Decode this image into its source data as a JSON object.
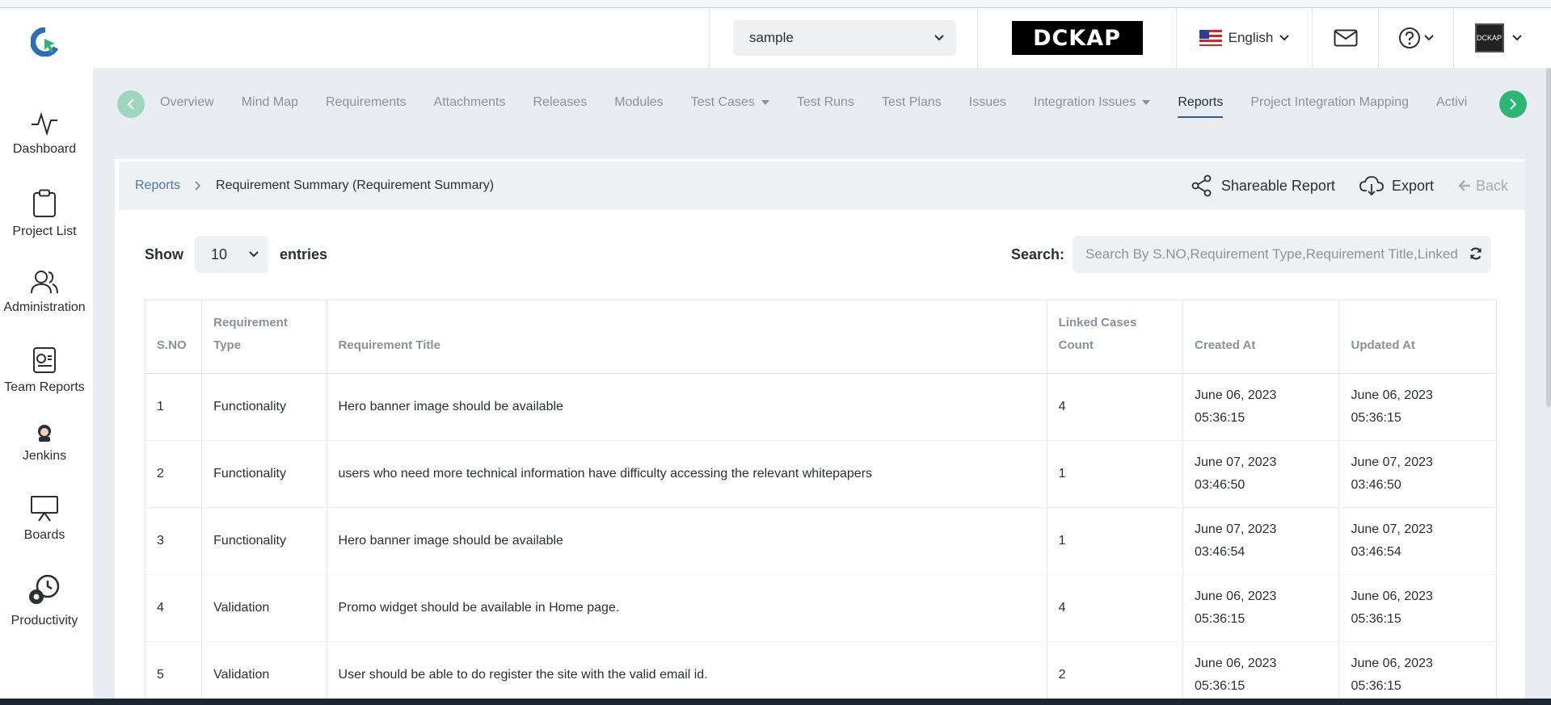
{
  "header": {
    "project_select": "sample",
    "brand": "DCKAP",
    "language": "English",
    "avatar_text": "DCKAP"
  },
  "sidebar": {
    "items": [
      {
        "label": "Dashboard",
        "icon": "activity-icon"
      },
      {
        "label": "Project List",
        "icon": "clipboard-icon"
      },
      {
        "label": "Administration",
        "icon": "users-icon"
      },
      {
        "label": "Team Reports",
        "icon": "report-icon"
      },
      {
        "label": "Jenkins",
        "icon": "jenkins-icon"
      },
      {
        "label": "Boards",
        "icon": "presentation-icon"
      },
      {
        "label": "Productivity",
        "icon": "gear-clock-icon"
      }
    ]
  },
  "tabs": [
    {
      "label": "Overview"
    },
    {
      "label": "Mind Map"
    },
    {
      "label": "Requirements"
    },
    {
      "label": "Attachments"
    },
    {
      "label": "Releases"
    },
    {
      "label": "Modules"
    },
    {
      "label": "Test Cases"
    },
    {
      "label": "Test Runs"
    },
    {
      "label": "Test Plans"
    },
    {
      "label": "Issues"
    },
    {
      "label": "Integration Issues"
    },
    {
      "label": "Reports"
    },
    {
      "label": "Project Integration Mapping"
    },
    {
      "label": "Activi"
    }
  ],
  "breadcrumb": {
    "root": "Reports",
    "current": "Requirement Summary (Requirement Summary)"
  },
  "actions": {
    "share": "Shareable Report",
    "export": "Export",
    "back": "Back"
  },
  "controls": {
    "show_label": "Show",
    "entries_value": "10",
    "entries_label": "entries",
    "search_label": "Search:",
    "search_placeholder": "Search By S.NO,Requirement Type,Requirement Title,Linked Cases Count"
  },
  "table": {
    "headers": {
      "sno": "S.NO",
      "type_line1": "Requirement",
      "type_line2": "Type",
      "title": "Requirement Title",
      "linked_line1": "Linked Cases",
      "linked_line2": "Count",
      "created": "Created At",
      "updated": "Updated At"
    },
    "rows": [
      {
        "sno": "1",
        "type": "Functionality",
        "title": "Hero banner image should be available",
        "linked": "4",
        "created_date": "June 06, 2023",
        "created_time": "05:36:15",
        "updated_date": "June 06, 2023",
        "updated_time": "05:36:15"
      },
      {
        "sno": "2",
        "type": "Functionality",
        "title": "users who need more technical information have difficulty accessing the relevant whitepapers",
        "linked": "1",
        "created_date": "June 07, 2023",
        "created_time": "03:46:50",
        "updated_date": "June 07, 2023",
        "updated_time": "03:46:50"
      },
      {
        "sno": "3",
        "type": "Functionality",
        "title": "Hero banner image should be available",
        "linked": "1",
        "created_date": "June 07, 2023",
        "created_time": "03:46:54",
        "updated_date": "June 07, 2023",
        "updated_time": "03:46:54"
      },
      {
        "sno": "4",
        "type": "Validation",
        "title": "Promo widget should be available in Home page.",
        "linked": "4",
        "created_date": "June 06, 2023",
        "created_time": "05:36:15",
        "updated_date": "June 06, 2023",
        "updated_time": "05:36:15"
      },
      {
        "sno": "5",
        "type": "Validation",
        "title": "User should be able to do register the site with the valid email id.",
        "linked": "2",
        "created_date": "June 06, 2023",
        "created_time": "05:36:15",
        "updated_date": "June 06, 2023",
        "updated_time": "05:36:15"
      }
    ]
  },
  "colors": {
    "active_tab_underline": "#2e5d86",
    "nav_arrow_left": "#9cd6be",
    "nav_arrow_right": "#2bb673",
    "link": "#4b78a8"
  }
}
